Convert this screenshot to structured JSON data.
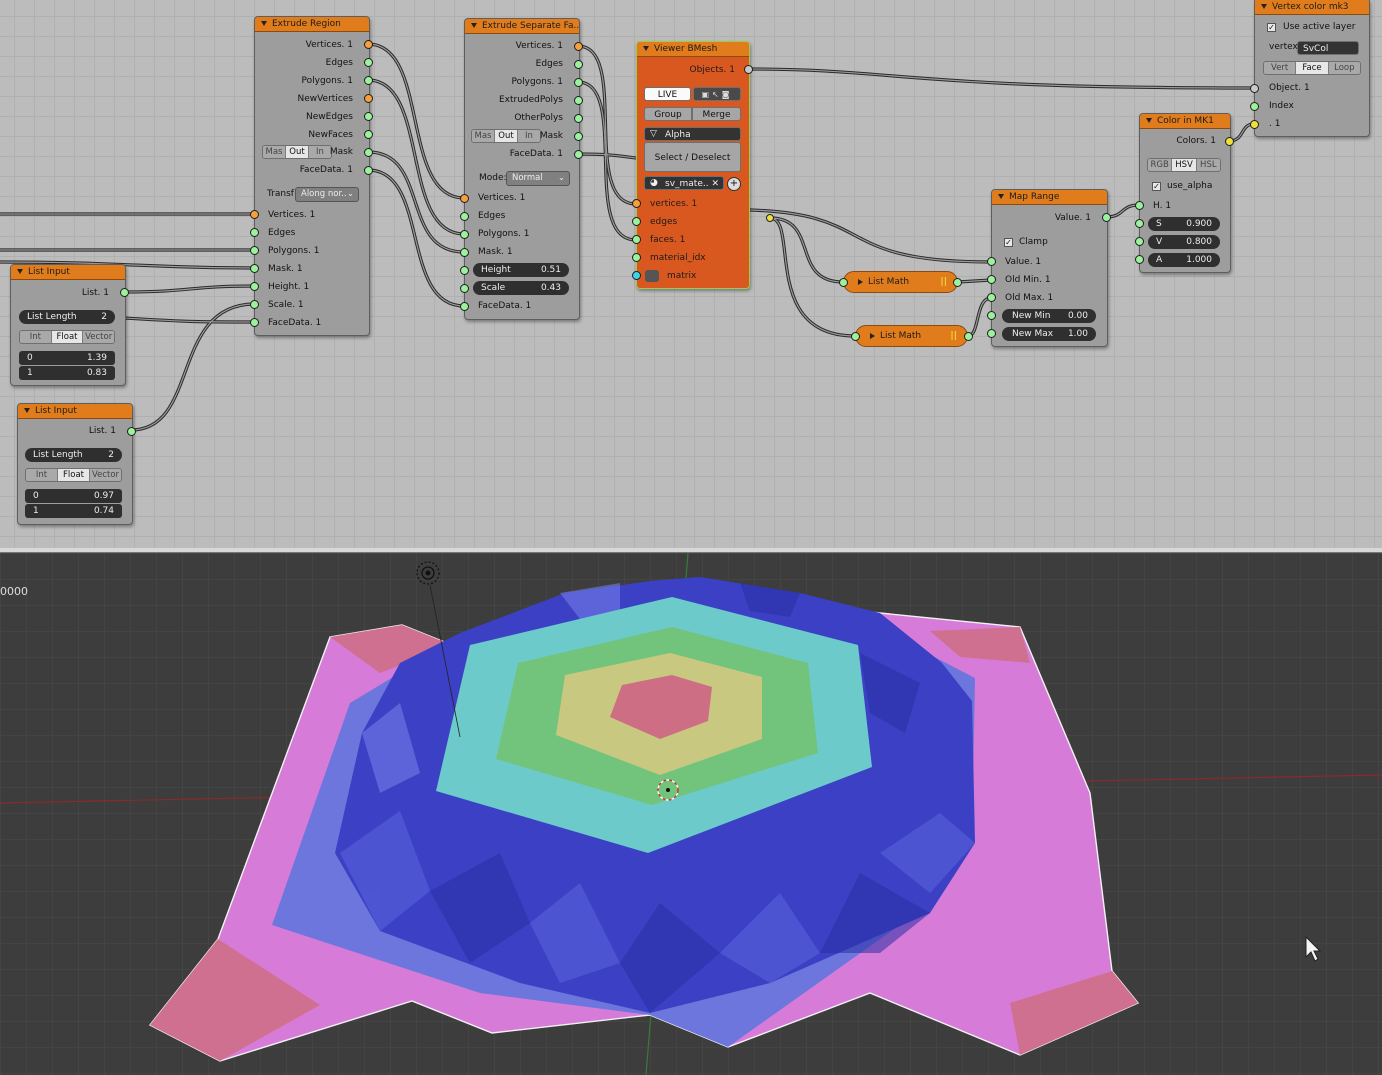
{
  "extrude_region": {
    "title": "Extrude Region",
    "outputs": [
      "Vertices. 1",
      "Edges",
      "Polygons. 1",
      "NewVertices",
      "NewEdges",
      "NewFaces"
    ],
    "mask_label": "Mask",
    "mask_modes": [
      "Mas",
      "Out",
      "In"
    ],
    "facedata_out": "FaceData. 1",
    "transform_label": "Transf",
    "transform_value": "Along nor..",
    "inputs": [
      "Vertices. 1",
      "Edges",
      "Polygons. 1",
      "Mask. 1",
      "Height. 1",
      "Scale. 1",
      "FaceData. 1"
    ]
  },
  "extrude_separate": {
    "title": "Extrude Separate Fa..",
    "outputs": [
      "Vertices. 1",
      "Edges",
      "Polygons. 1",
      "ExtrudedPolys",
      "OtherPolys"
    ],
    "mask_label": "Mask",
    "mask_modes": [
      "Mas",
      "Out",
      "In"
    ],
    "facedata_out": "FaceData. 1",
    "mode_label": "Mode:",
    "mode_value": "Normal",
    "inputs": [
      "Vertices. 1",
      "Edges",
      "Polygons. 1",
      "Mask. 1"
    ],
    "height_label": "Height",
    "height_value": "0.51",
    "scale_label": "Scale",
    "scale_value": "0.43",
    "facedata_in": "FaceData. 1"
  },
  "viewer_bmesh": {
    "title": "Viewer BMesh",
    "objects_out": "Objects. 1",
    "live_label": "LIVE",
    "group_label": "Group",
    "merge_label": "Merge",
    "alpha_label": "Alpha",
    "select_label": "Select / Deselect",
    "material_value": "sv_mate..",
    "inputs": [
      "vertices. 1",
      "edges",
      "faces. 1",
      "material_idx",
      "matrix"
    ]
  },
  "vertex_color": {
    "title": "Vertex color mk3",
    "use_active_label": "Use active layer",
    "vertex_label": "vertex",
    "vertex_value": "SvCol",
    "modes": [
      "Vert",
      "Face",
      "Loop"
    ],
    "inputs": [
      "Object. 1",
      "Index",
      ". 1"
    ]
  },
  "color_in": {
    "title": "Color in MK1",
    "output": "Colors. 1",
    "modes": [
      "RGB",
      "HSV",
      "HSL"
    ],
    "use_alpha_label": "use_alpha",
    "h_label": "H. 1",
    "s_label": "S",
    "s_value": "0.900",
    "v_label": "V",
    "v_value": "0.800",
    "a_label": "A",
    "a_value": "1.000"
  },
  "map_range": {
    "title": "Map Range",
    "output": "Value. 1",
    "clamp_label": "Clamp",
    "inputs": [
      "Value. 1",
      "Old Min. 1",
      "Old Max. 1"
    ],
    "new_min_label": "New Min",
    "new_min_value": "0.00",
    "new_max_label": "New Max",
    "new_max_value": "1.00"
  },
  "list_math_1": {
    "title": "List Math"
  },
  "list_math_2": {
    "title": "List Math"
  },
  "list_input_1": {
    "title": "List Input",
    "output": "List. 1",
    "length_label": "List Length",
    "length_value": "2",
    "modes": [
      "Int",
      "Float",
      "Vector"
    ],
    "items": [
      {
        "index": "0",
        "value": "1.39"
      },
      {
        "index": "1",
        "value": "0.83"
      }
    ]
  },
  "list_input_2": {
    "title": "List Input",
    "output": "List. 1",
    "length_label": "List Length",
    "length_value": "2",
    "modes": [
      "Int",
      "Float",
      "Vector"
    ],
    "items": [
      {
        "index": "0",
        "value": "0.97"
      },
      {
        "index": "1",
        "value": "0.74"
      }
    ]
  },
  "viewport": {
    "readout": "0000"
  },
  "colors": {
    "node_header": "#e07c1c",
    "node_body": "#9d9d9d",
    "viewer_body": "#d9581f",
    "socket_green": "#9cf29c",
    "socket_orange": "#f5a03c",
    "socket_yellow": "#f0e03a",
    "socket_cyan": "#3bd3ee",
    "mesh_pink": "#d97ed8",
    "mesh_blue": "#6b78e0",
    "mesh_cyan": "#6ccaca",
    "mesh_green": "#72c47c",
    "mesh_yellow": "#c8c880",
    "mesh_red": "#cd6e84"
  }
}
